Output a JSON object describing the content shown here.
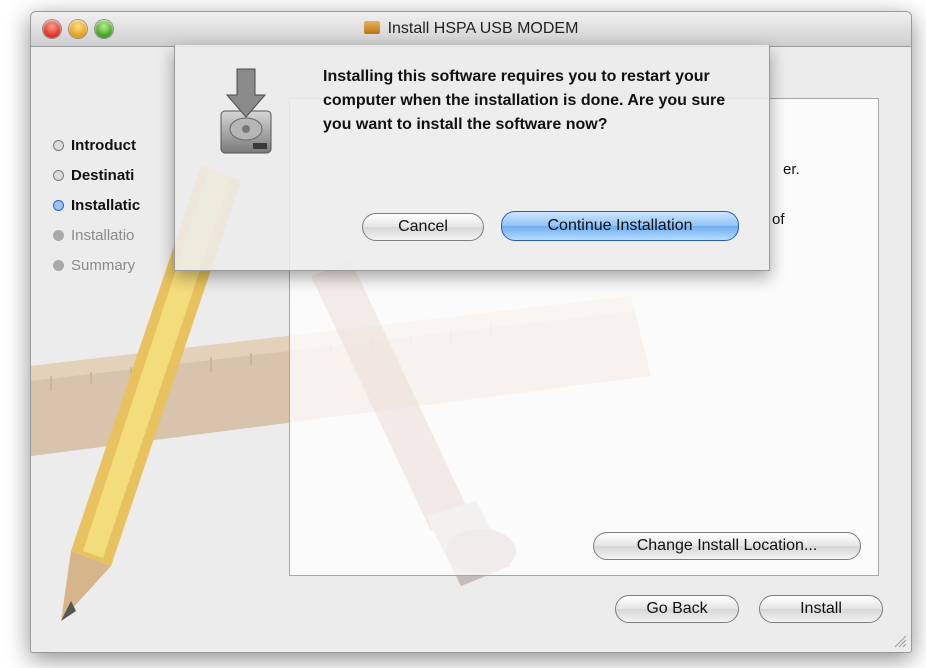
{
  "window": {
    "title": "Install HSPA USB MODEM",
    "title_icon": "package-icon"
  },
  "sidebar": {
    "steps": [
      {
        "label": "Introduct",
        "state": "done"
      },
      {
        "label": "Destinati",
        "state": "done"
      },
      {
        "label": "Installatic",
        "state": "current"
      },
      {
        "label": "Installatio",
        "state": "pending"
      },
      {
        "label": "Summary",
        "state": "pending"
      }
    ]
  },
  "content": {
    "partial_line1_end": "er.",
    "partial_line2_end": "of",
    "change_location_label": "Change Install Location..."
  },
  "footer": {
    "go_back_label": "Go Back",
    "install_label": "Install"
  },
  "dialog": {
    "message": "Installing this software requires you to restart your computer when the installation is done. Are you sure you want to install the software now?",
    "cancel_label": "Cancel",
    "continue_label": "Continue Installation",
    "icon": "install-disk-icon"
  },
  "colors": {
    "accent_blue": "#6fadf0",
    "window_bg": "#ececec"
  }
}
